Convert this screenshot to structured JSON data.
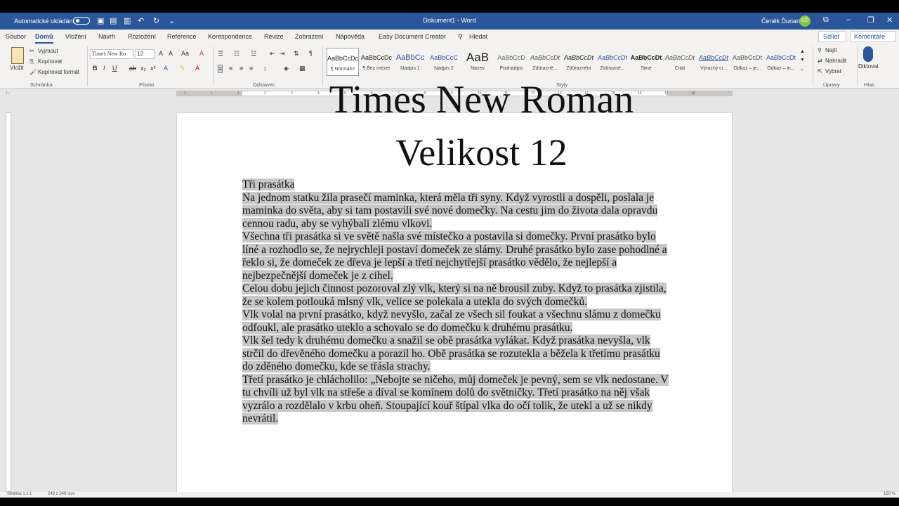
{
  "titlebar": {
    "autosave_label": "Automatické ukládání",
    "document_title": "Dokument1 - Word",
    "user_name": "Čeněk Ďurian",
    "user_initials": "CĎ"
  },
  "tabs": [
    "Soubor",
    "Domů",
    "Vložení",
    "Návrh",
    "Rozložení",
    "Reference",
    "Korespondence",
    "Revize",
    "Zobrazení",
    "Nápověda",
    "Easy Document Creator",
    "Hledat"
  ],
  "active_tab": "Domů",
  "share_label": "Sdílet",
  "comments_label": "Komentáře",
  "ribbon": {
    "clipboard": {
      "paste": "Vložit",
      "cut": "Vyjmout",
      "copy": "Kopírovat",
      "format_painter": "Kopírovat formát",
      "group": "Schránka"
    },
    "font": {
      "name": "Times New Ro",
      "size": "12",
      "group": "Písmo"
    },
    "paragraph": {
      "group": "Odstavec"
    },
    "styles": {
      "group": "Styly",
      "items": [
        {
          "sample": "AaBbCcDc",
          "name": "¶ Normální"
        },
        {
          "sample": "AaBbCcDc",
          "name": "¶ Bez mezer"
        },
        {
          "sample": "AaBbCc",
          "name": "Nadpis 1"
        },
        {
          "sample": "AaBbCcC",
          "name": "Nadpis 2"
        },
        {
          "sample": "AaB",
          "name": "Název"
        },
        {
          "sample": "AaBbCcD",
          "name": "Podnadpis"
        },
        {
          "sample": "AaBbCcDt",
          "name": "Zdůrazně..."
        },
        {
          "sample": "AaBbCcDt",
          "name": "Zdůraznění"
        },
        {
          "sample": "AaBbCcDt",
          "name": "Zdůrazně..."
        },
        {
          "sample": "AaBbCcDt",
          "name": "Silné"
        },
        {
          "sample": "AaBbCcDt",
          "name": "Citát"
        },
        {
          "sample": "AaBbCcDt",
          "name": "Výrazný ci..."
        },
        {
          "sample": "AaBbCcDt",
          "name": "Odkaz – je..."
        },
        {
          "sample": "AaBbCcDt",
          "name": "Odkaz – in..."
        }
      ]
    },
    "editing": {
      "find": "Najít",
      "replace": "Nahradit",
      "select": "Vybrat",
      "group": "Úpravy"
    },
    "voice": {
      "dictate": "Diktovat",
      "group": "Hlas"
    }
  },
  "ruler_numbers": [
    "2",
    "1",
    "1",
    "2",
    "3",
    "4",
    "5",
    "6",
    "7",
    "8",
    "9",
    "10",
    "11",
    "12",
    "13",
    "14",
    "15",
    "16",
    "17",
    "18"
  ],
  "document": {
    "overlay_line1": "Times New Roman",
    "overlay_line2": "Velikost 12",
    "paragraphs": [
      "Tři prasátka",
      "Na jednom statku žila prasečí maminka, která měla tři syny. Když vyrostli a dospěli, poslala je maminka do světa, aby si tam postavili své nové domečky. Na cestu jim do života dala opravdu cennou radu, aby se vyhýbali zlému vlkovi.",
      "Všechna tři prasátka si ve světě našla své místečko a postavila si domečky. První prasátko bylo líné a rozhodlo se, že nejrychleji postaví domeček ze slámy. Druhé prasátko bylo zase pohodlné a řeklo si, že domeček ze dřeva je lepší a třetí nejchytřejší prasátko vědělo, že nejlepší a nejbezpečnější domeček je z cihel.",
      "Celou dobu jejich činnost pozoroval zlý vlk, který si na ně brousil zuby. Když to prasátka zjistila, že se kolem potlouká mlsný vlk, velice se polekala a utekla do svých domečků.",
      "Vlk volal na první prasátko, když nevyšlo, začal ze všech sil foukat a všechnu slámu z domečku odfoukl, ale prasátko uteklo a schovalo se do domečku k druhému prasátku.",
      "Vlk šel tedy k druhému domečku a snažil se obě prasátka vylákat. Když prasátka nevyšla, vlk strčil do dřevěného domečku a porazil ho. Obě prasátka se rozutekla a běžela k třetímu prasátku do zděného domečku, kde se třásla strachy.",
      "Třetí prasátko je chlácholilo: „Nebojte se ničeho, můj domeček je pevný, sem se vlk nedostane. V tu chvíli už byl vlk na střeše a díval se komínem dolů do světničky. Třetí prasátko na něj však vyzrálo a rozdělalo v krbu oheň. Stoupající kouř štípal vlka do očí tolik, že utekl a už se nikdy nevrátil."
    ]
  },
  "status": {
    "page": "Stránka 1 z 1",
    "words": "249 z 249 slov",
    "zoom": "150 %"
  }
}
